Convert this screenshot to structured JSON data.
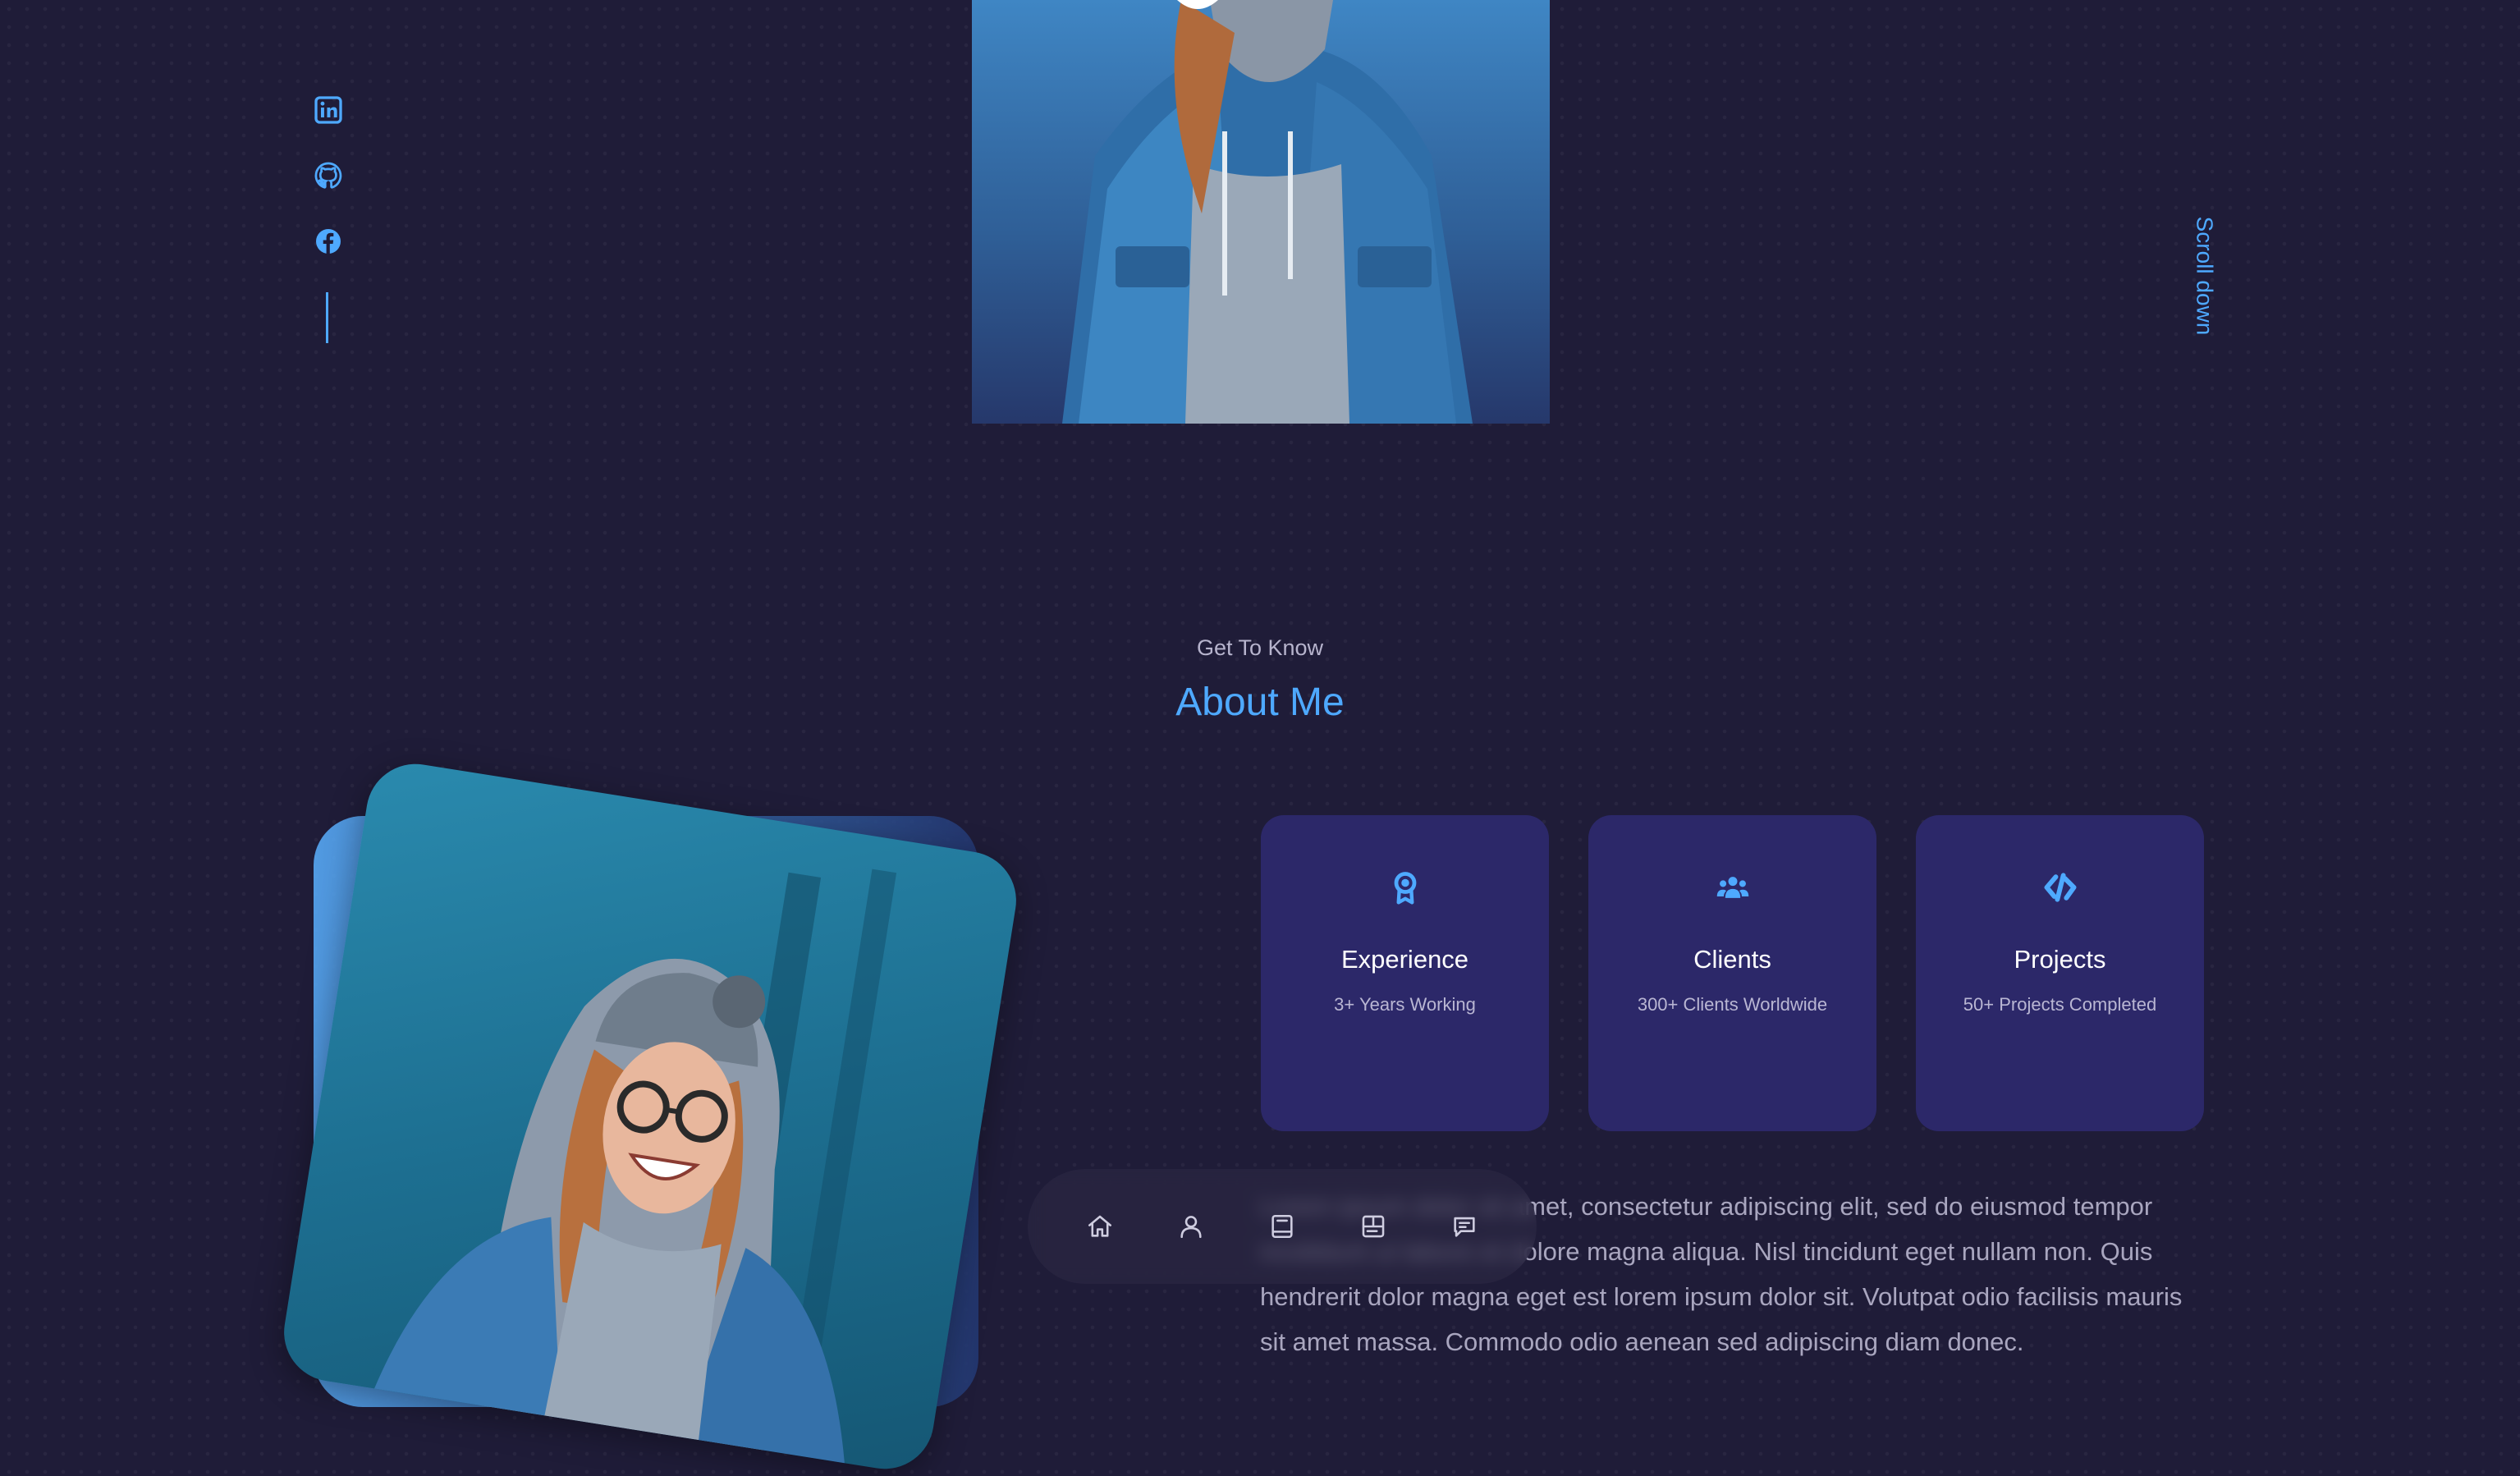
{
  "hero": {
    "image_alt": "Woman in hoodie and denim jacket"
  },
  "social": {
    "items": [
      {
        "name": "linkedin",
        "icon": "linkedin-icon"
      },
      {
        "name": "github",
        "icon": "github-icon"
      },
      {
        "name": "facebook",
        "icon": "facebook-icon"
      }
    ]
  },
  "scroll_down": {
    "label": "Scroll down"
  },
  "section": {
    "subtitle": "Get To Know",
    "title": "About Me"
  },
  "about_photo": {
    "image_alt": "Smiling woman with glasses in grey hoodie"
  },
  "cards": [
    {
      "title": "Experience",
      "sub": "3+ Years Working",
      "icon": "award-icon"
    },
    {
      "title": "Clients",
      "sub": "300+ Clients Worldwide",
      "icon": "users-icon"
    },
    {
      "title": "Projects",
      "sub": "50+ Projects Completed",
      "icon": "code-icon"
    }
  ],
  "about_text": "Lorem ipsum dolor sit amet, consectetur adipiscing elit, sed do eiusmod tempor incididunt ut labore et dolore magna aliqua. Nisl tincidunt eget nullam non. Quis hendrerit dolor magna eget est lorem ipsum dolor sit. Volutpat odio facilisis mauris sit amet massa. Commodo odio aenean sed adipiscing diam donec.",
  "nav": {
    "items": [
      {
        "name": "home",
        "icon": "home-icon"
      },
      {
        "name": "about",
        "icon": "user-icon"
      },
      {
        "name": "experience",
        "icon": "book-icon"
      },
      {
        "name": "services",
        "icon": "layout-icon"
      },
      {
        "name": "contact",
        "icon": "message-icon"
      }
    ]
  },
  "colors": {
    "background": "#1f1c38",
    "accent": "#4ea9ff",
    "card": "#2c2869",
    "text_muted": "#a9a6bf"
  }
}
